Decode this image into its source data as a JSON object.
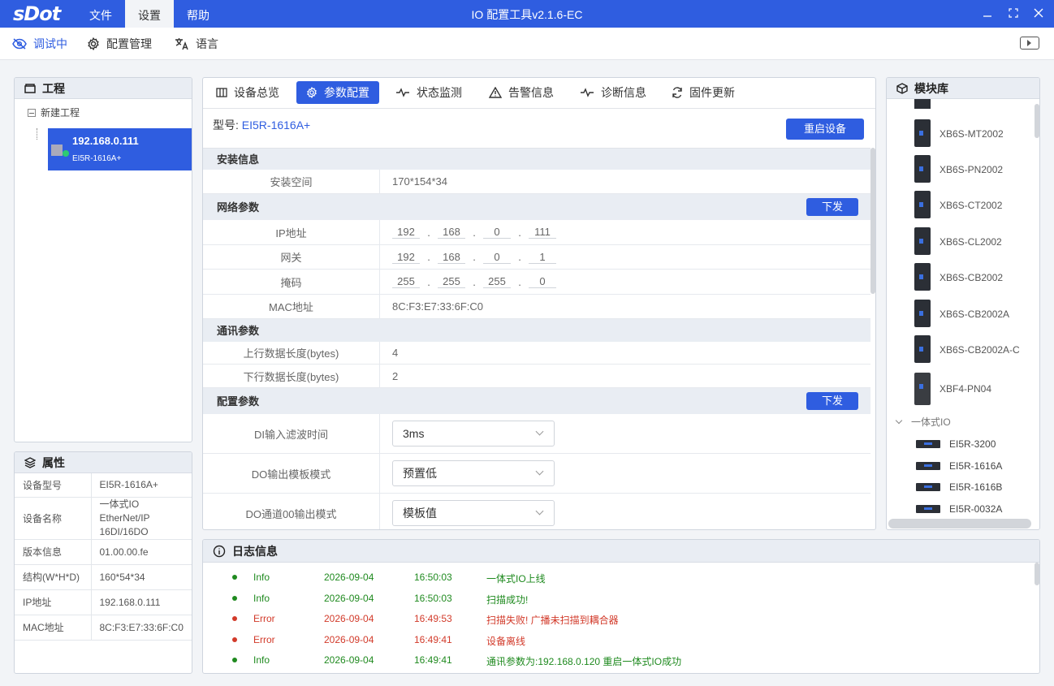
{
  "colors": {
    "primary": "#2f5de0",
    "info": "#1f8a1f",
    "error": "#d23a2a"
  },
  "titlebar": {
    "logo": "sDot",
    "menus": [
      "文件",
      "设置",
      "帮助"
    ],
    "active_menu": "设置",
    "title": "IO 配置工具v2.1.6-EC",
    "controls": [
      "minimize-icon",
      "maximize-icon",
      "close-icon"
    ]
  },
  "toolbar": {
    "debug_label": "调试中",
    "config_label": "配置管理",
    "language_label": "语言"
  },
  "project": {
    "title": "工程",
    "root_label": "新建工程",
    "device_ip": "192.168.0.111",
    "device_model": "EI5R-1616A+"
  },
  "properties": {
    "title": "属性",
    "rows": [
      {
        "label": "设备型号",
        "value": "EI5R-1616A+"
      },
      {
        "label": "设备名称",
        "value": "一体式IO EtherNet/IP 16DI/16DO"
      },
      {
        "label": "版本信息",
        "value": "01.00.00.fe"
      },
      {
        "label": "结构(W*H*D)",
        "value": "160*54*34"
      },
      {
        "label": "IP地址",
        "value": "192.168.0.111"
      },
      {
        "label": "MAC地址",
        "value": "8C:F3:E7:33:6F:C0"
      }
    ]
  },
  "main": {
    "tabs": [
      "设备总览",
      "参数配置",
      "状态监测",
      "告警信息",
      "诊断信息",
      "固件更新"
    ],
    "active_tab": "参数配置",
    "model_label": "型号:",
    "model_value": "EI5R-1616A+",
    "restart_label": "重启设备",
    "send_label": "下发",
    "install": {
      "title": "安装信息",
      "space_label": "安装空间",
      "space_value": "170*154*34"
    },
    "network": {
      "title": "网络参数",
      "ip_label": "IP地址",
      "ip": [
        "192",
        "168",
        "0",
        "111"
      ],
      "gateway_label": "网关",
      "gateway": [
        "192",
        "168",
        "0",
        "1"
      ],
      "mask_label": "掩码",
      "mask": [
        "255",
        "255",
        "255",
        "0"
      ],
      "mac_label": "MAC地址",
      "mac": "8C:F3:E7:33:6F:C0"
    },
    "comm": {
      "title": "通讯参数",
      "up_label": "上行数据长度(bytes)",
      "up_value": "4",
      "down_label": "下行数据长度(bytes)",
      "down_value": "2"
    },
    "config": {
      "title": "配置参数",
      "di_filter_label": "DI输入滤波时间",
      "di_filter_value": "3ms",
      "do_mode_label": "DO输出模板模式",
      "do_mode_value": "预置低",
      "do_ch00_label": "DO通道00输出模式",
      "do_ch00_value": "模板值"
    }
  },
  "modules": {
    "title": "模块库",
    "items": [
      "XB6S-MT2002",
      "XB6S-PN2002",
      "XB6S-CT2002",
      "XB6S-CL2002",
      "XB6S-CB2002",
      "XB6S-CB2002A",
      "XB6S-CB2002A-C",
      "XBF4-PN04"
    ],
    "group_label": "一体式IO",
    "group_items": [
      "EI5R-3200",
      "EI5R-1616A",
      "EI5R-1616B",
      "EI5R-0032A"
    ]
  },
  "log": {
    "title": "日志信息",
    "entries": [
      {
        "level": "Info",
        "date": "2026-09-04",
        "time": "16:50:03",
        "message": "一体式IO上线"
      },
      {
        "level": "Info",
        "date": "2026-09-04",
        "time": "16:50:03",
        "message": "扫描成功!"
      },
      {
        "level": "Error",
        "date": "2026-09-04",
        "time": "16:49:53",
        "message": "扫描失败! 广播未扫描到耦合器"
      },
      {
        "level": "Error",
        "date": "2026-09-04",
        "time": "16:49:41",
        "message": "设备离线"
      },
      {
        "level": "Info",
        "date": "2026-09-04",
        "time": "16:49:41",
        "message": "通讯参数为:192.168.0.120 重启一体式IO成功"
      }
    ]
  }
}
